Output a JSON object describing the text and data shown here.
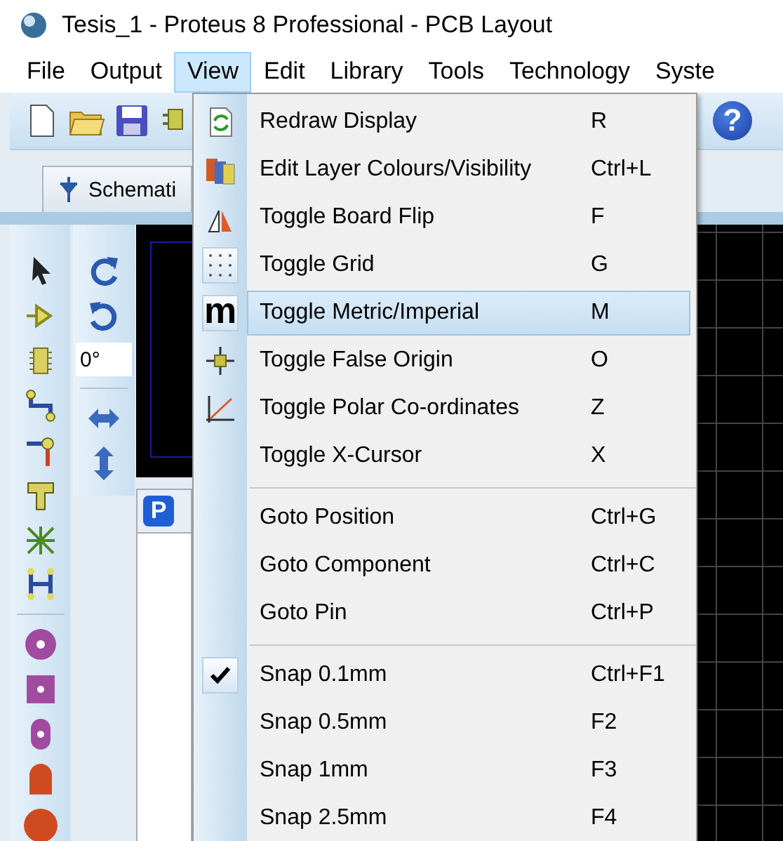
{
  "window": {
    "title": "Tesis_1 - Proteus 8 Professional - PCB Layout"
  },
  "menu_bar": [
    {
      "label": "File",
      "selected": false
    },
    {
      "label": "Output",
      "selected": false
    },
    {
      "label": "View",
      "selected": true
    },
    {
      "label": "Edit",
      "selected": false
    },
    {
      "label": "Library",
      "selected": false
    },
    {
      "label": "Tools",
      "selected": false
    },
    {
      "label": "Technology",
      "selected": false
    },
    {
      "label": "Syste",
      "selected": false
    }
  ],
  "toolbar": {
    "help_button": "?"
  },
  "document_tab": {
    "label": "Schemati"
  },
  "left_panel": {
    "rotation_field": {
      "value": "0°"
    },
    "panel_button": "P"
  },
  "view_menu": {
    "items": [
      {
        "kind": "item",
        "label": "Redraw Display",
        "shortcut": "R",
        "checked": false,
        "selected": false
      },
      {
        "kind": "item",
        "label": "Edit Layer Colours/Visibility",
        "shortcut": "Ctrl+L",
        "checked": false,
        "selected": false
      },
      {
        "kind": "item",
        "label": "Toggle Board Flip",
        "shortcut": "F",
        "checked": false,
        "selected": false
      },
      {
        "kind": "item",
        "label": "Toggle Grid",
        "shortcut": "G",
        "checked": true,
        "selected": false
      },
      {
        "kind": "item",
        "label": "Toggle Metric/Imperial",
        "shortcut": "M",
        "checked": true,
        "selected": true,
        "icon_text": "m"
      },
      {
        "kind": "item",
        "label": "Toggle False Origin",
        "shortcut": "O",
        "checked": false,
        "selected": false
      },
      {
        "kind": "item",
        "label": "Toggle Polar Co-ordinates",
        "shortcut": "Z",
        "checked": false,
        "selected": false
      },
      {
        "kind": "item",
        "label": "Toggle X-Cursor",
        "shortcut": "X",
        "checked": false,
        "selected": false
      },
      {
        "kind": "separator"
      },
      {
        "kind": "item",
        "label": "Goto Position",
        "shortcut": "Ctrl+G",
        "checked": false,
        "selected": false
      },
      {
        "kind": "item",
        "label": "Goto Component",
        "shortcut": "Ctrl+C",
        "checked": false,
        "selected": false
      },
      {
        "kind": "item",
        "label": "Goto Pin",
        "shortcut": "Ctrl+P",
        "checked": false,
        "selected": false
      },
      {
        "kind": "separator"
      },
      {
        "kind": "item",
        "label": "Snap 0.1mm",
        "shortcut": "Ctrl+F1",
        "checked": true,
        "selected": false
      },
      {
        "kind": "item",
        "label": "Snap 0.5mm",
        "shortcut": "F2",
        "checked": false,
        "selected": false
      },
      {
        "kind": "item",
        "label": "Snap 1mm",
        "shortcut": "F3",
        "checked": false,
        "selected": false
      },
      {
        "kind": "item",
        "label": "Snap 2.5mm",
        "shortcut": "F4",
        "checked": false,
        "selected": false
      }
    ]
  }
}
